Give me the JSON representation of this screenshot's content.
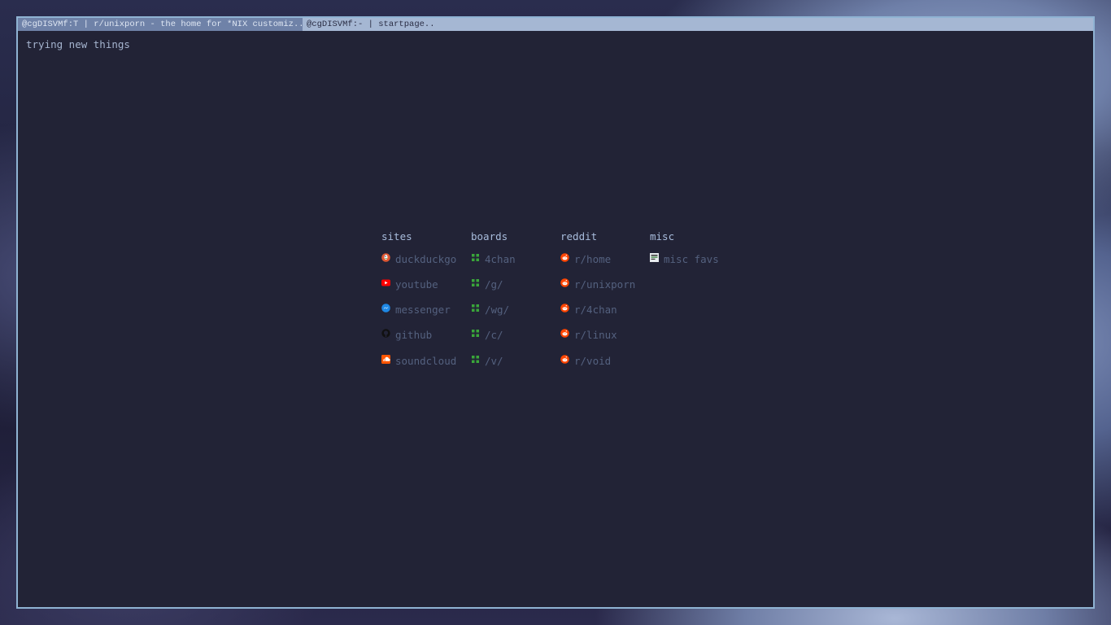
{
  "tabs": [
    {
      "label": "@cgDISVMf:T | r/unixporn - the home for *NIX customiz..."
    },
    {
      "label": "@cgDISVMf:- | startpage.."
    }
  ],
  "note": "trying new things",
  "columns": [
    {
      "title": "sites",
      "links": [
        {
          "label": "duckduckgo",
          "icon": "duckduckgo-icon"
        },
        {
          "label": "youtube",
          "icon": "youtube-icon"
        },
        {
          "label": "messenger",
          "icon": "messenger-icon"
        },
        {
          "label": "github",
          "icon": "github-icon"
        },
        {
          "label": "soundcloud",
          "icon": "soundcloud-icon"
        }
      ]
    },
    {
      "title": "boards",
      "links": [
        {
          "label": "4chan",
          "icon": "clover-icon"
        },
        {
          "label": "/g/",
          "icon": "clover-icon"
        },
        {
          "label": "/wg/",
          "icon": "clover-icon"
        },
        {
          "label": "/c/",
          "icon": "clover-icon"
        },
        {
          "label": "/v/",
          "icon": "clover-icon"
        }
      ]
    },
    {
      "title": "reddit",
      "links": [
        {
          "label": "r/home",
          "icon": "reddit-icon"
        },
        {
          "label": "r/unixporn",
          "icon": "reddit-icon"
        },
        {
          "label": "r/4chan",
          "icon": "reddit-icon"
        },
        {
          "label": "r/linux",
          "icon": "reddit-icon"
        },
        {
          "label": "r/void",
          "icon": "reddit-icon"
        }
      ]
    },
    {
      "title": "misc",
      "links": [
        {
          "label": "misc favs",
          "icon": "favicon-icon"
        }
      ]
    }
  ],
  "colors": {
    "window_bg": "#222336",
    "border": "#8fb3d3",
    "active_tab_bg": "#6f82a8",
    "inactive_tab_bg": "#a5b7d3",
    "link_text": "#54617f",
    "title_text": "#a8bcdc"
  }
}
